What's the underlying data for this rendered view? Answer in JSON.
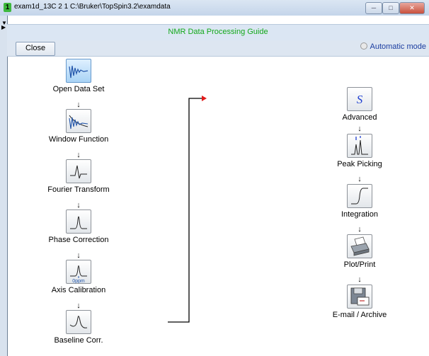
{
  "window": {
    "badge": "1",
    "title": "exam1d_13C  2  1  C:\\Bruker\\TopSpin3.2\\examdata"
  },
  "header": {
    "title": "NMR Data Processing Guide"
  },
  "toolbar": {
    "close_label": "Close",
    "auto_mode_label": "Automatic mode"
  },
  "left_steps": [
    {
      "label": "Open Data Set",
      "icon": "fid-icon"
    },
    {
      "label": "Window Function",
      "icon": "window-function-icon"
    },
    {
      "label": "Fourier Transform",
      "icon": "fourier-icon"
    },
    {
      "label": "Phase Correction",
      "icon": "peak-icon"
    },
    {
      "label": "Axis Calibration",
      "icon": "axis-calibration-icon",
      "unit": "0ppm"
    },
    {
      "label": "Baseline Corr.",
      "icon": "baseline-icon"
    }
  ],
  "right_steps": [
    {
      "label": "Advanced",
      "icon": "script-s-icon",
      "glyph": "S"
    },
    {
      "label": "Peak Picking",
      "icon": "peak-picking-icon"
    },
    {
      "label": "Integration",
      "icon": "integral-icon"
    },
    {
      "label": "Plot/Print",
      "icon": "printer-icon"
    },
    {
      "label": "E-mail / Archive",
      "icon": "floppy-email-icon"
    }
  ],
  "arrow_glyph": "↓"
}
